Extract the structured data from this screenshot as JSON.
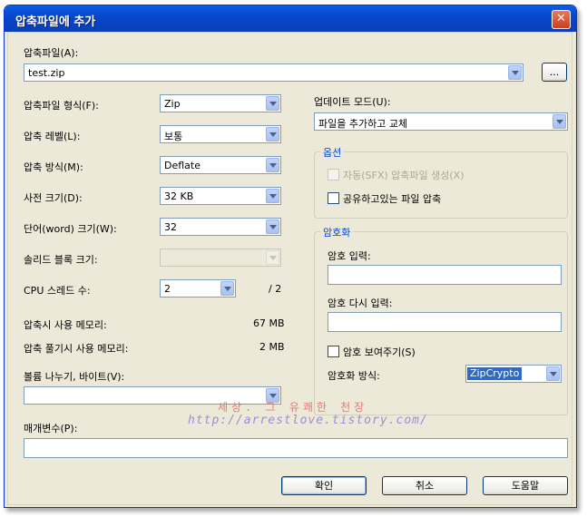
{
  "window": {
    "title": "압축파일에 추가",
    "close_glyph": "✕"
  },
  "archive": {
    "label": "압축파일(A):",
    "value": "test.zip",
    "browse_label": "..."
  },
  "format": {
    "label": "압축파일 형식(F):",
    "value": "Zip"
  },
  "level": {
    "label": "압축 레벨(L):",
    "value": "보통"
  },
  "method": {
    "label": "압축 방식(M):",
    "value": "Deflate"
  },
  "dictionary": {
    "label": "사전 크기(D):",
    "value": "32 KB"
  },
  "word": {
    "label": "단어(word) 크기(W):",
    "value": "32"
  },
  "solid": {
    "label": "솔리드 블록 크기:",
    "value": ""
  },
  "threads": {
    "label": "CPU 스레드 수:",
    "value": "2",
    "total": "/ 2"
  },
  "memory": {
    "compress_label": "압축시 사용 메모리:",
    "compress_value": "67 MB",
    "decompress_label": "압축 풀기시 사용 메모리:",
    "decompress_value": "2 MB"
  },
  "volume": {
    "label": "볼륨 나누기, 바이트(V):",
    "value": ""
  },
  "params": {
    "label": "매개변수(P):",
    "value": ""
  },
  "update": {
    "label": "업데이트 모드(U):",
    "value": "파일을 추가하고 교체"
  },
  "options": {
    "title": "옵션",
    "sfx_label": "자동(SFX) 압축파일 생성(X)",
    "shared_label": "공유하고있는 파일 압축"
  },
  "encryption": {
    "title": "암호화",
    "password_label": "암호 입력:",
    "reenter_label": "암호 다시 입력:",
    "show_label": "암호 보여주기(S)",
    "method_label": "암호화 방식:",
    "method_value": "ZipCrypto"
  },
  "buttons": {
    "ok": "확인",
    "cancel": "취소",
    "help": "도움말"
  },
  "watermark": {
    "line1": "세상. 그 유쾌한 천장",
    "line2": "http://arrestlove.tistory.com/"
  }
}
